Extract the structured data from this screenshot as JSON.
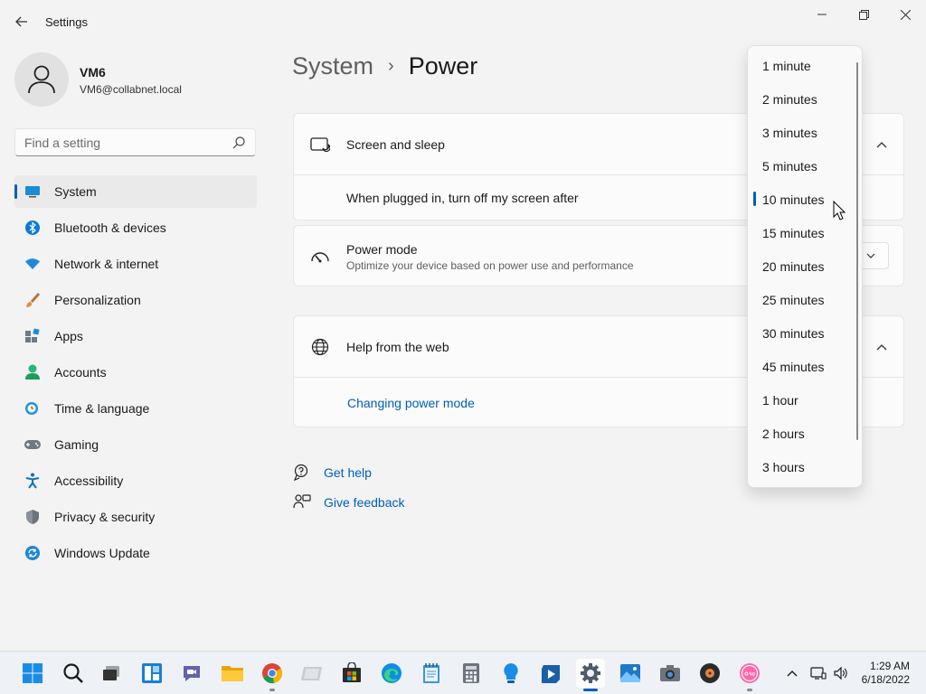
{
  "window": {
    "title": "Settings",
    "back_icon": "back-arrow-icon",
    "controls": [
      "minimize-icon",
      "maximize-icon",
      "close-icon"
    ]
  },
  "profile": {
    "name": "VM6",
    "email": "VM6@collabnet.local"
  },
  "search": {
    "placeholder": "Find a setting"
  },
  "sidebar": {
    "items": [
      {
        "label": "System",
        "icon": "system-icon",
        "active": true
      },
      {
        "label": "Bluetooth & devices",
        "icon": "bluetooth-icon"
      },
      {
        "label": "Network & internet",
        "icon": "network-icon"
      },
      {
        "label": "Personalization",
        "icon": "brush-icon"
      },
      {
        "label": "Apps",
        "icon": "apps-icon"
      },
      {
        "label": "Accounts",
        "icon": "accounts-icon"
      },
      {
        "label": "Time & language",
        "icon": "time-icon"
      },
      {
        "label": "Gaming",
        "icon": "gaming-icon"
      },
      {
        "label": "Accessibility",
        "icon": "accessibility-icon"
      },
      {
        "label": "Privacy & security",
        "icon": "shield-icon"
      },
      {
        "label": "Windows Update",
        "icon": "update-icon"
      }
    ]
  },
  "breadcrumb": {
    "parent": "System",
    "separator": "›",
    "current": "Power"
  },
  "screen_sleep": {
    "title": "Screen and sleep",
    "plugged_in_label": "When plugged in, turn off my screen after"
  },
  "power_mode": {
    "title": "Power mode",
    "description": "Optimize your device based on power use and performance"
  },
  "help_web": {
    "title": "Help from the web",
    "link": "Changing power mode"
  },
  "help_links": {
    "get_help": "Get help",
    "give_feedback": "Give feedback"
  },
  "dropdown": {
    "selected": "10 minutes",
    "options": [
      "1 minute",
      "2 minutes",
      "3 minutes",
      "5 minutes",
      "10 minutes",
      "15 minutes",
      "20 minutes",
      "25 minutes",
      "30 minutes",
      "45 minutes",
      "1 hour",
      "2 hours",
      "3 hours"
    ]
  },
  "taskbar": {
    "apps": [
      "start-icon",
      "search-icon",
      "task-view-icon",
      "widgets-icon",
      "teams-chat-icon",
      "file-explorer-icon",
      "chrome-icon",
      "photos-app-icon",
      "store-icon",
      "edge-icon",
      "notepad-icon",
      "calculator-icon",
      "tips-icon",
      "media-player-icon",
      "settings-icon",
      "photos-icon",
      "camera-icon",
      "groove-music-icon",
      "osu-icon"
    ],
    "time": "1:29 AM",
    "date": "6/18/2022"
  },
  "colors": {
    "accent": "#005fb8",
    "background": "#f3f3f3",
    "card": "#fbfbfb"
  }
}
